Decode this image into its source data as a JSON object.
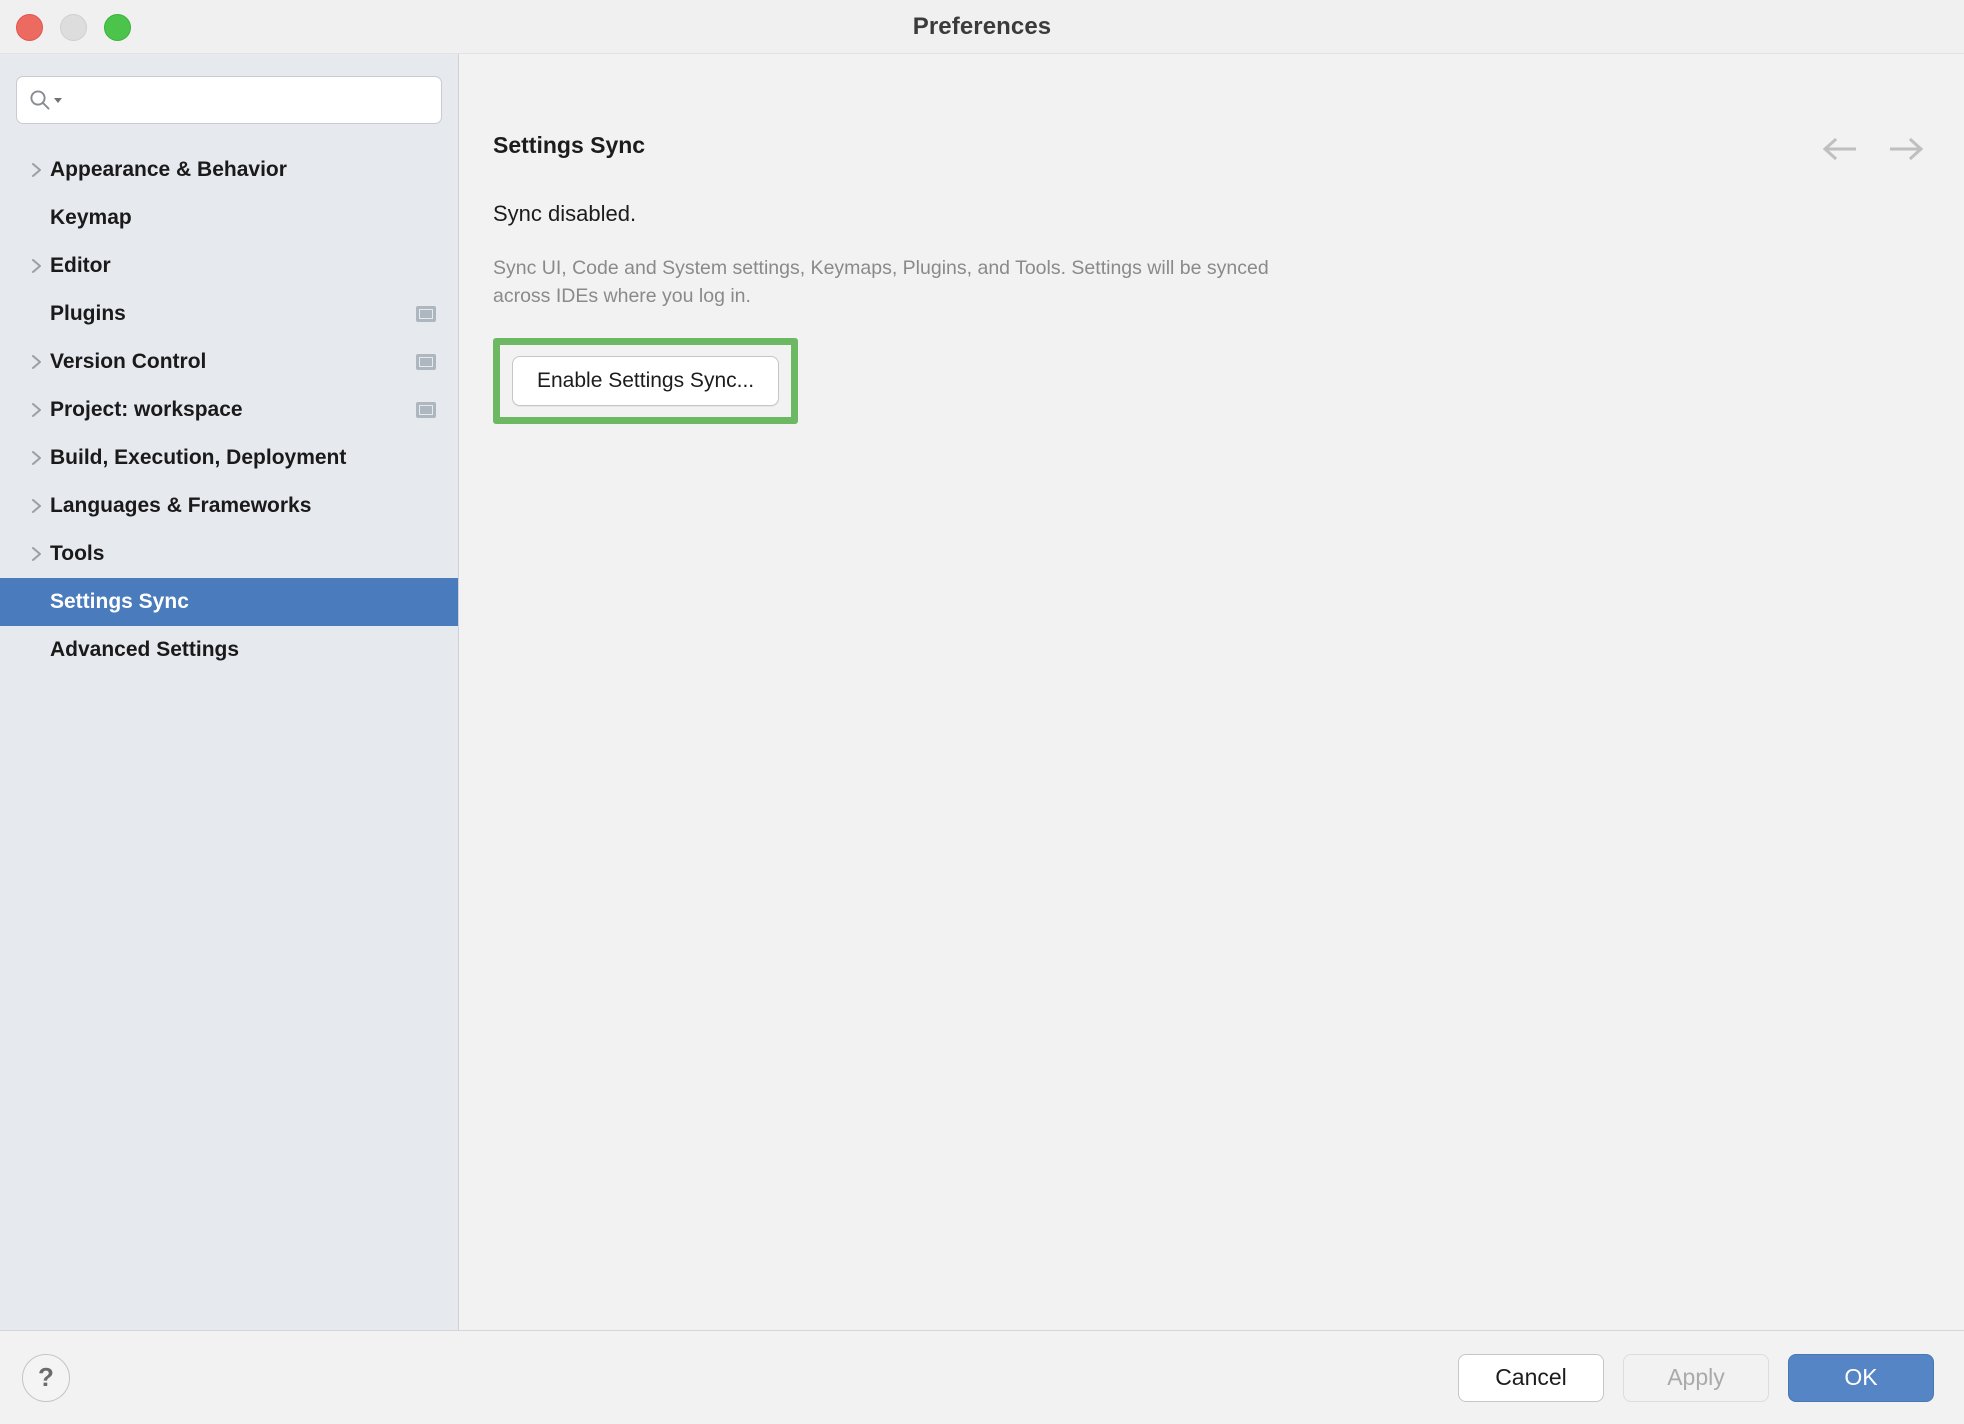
{
  "window": {
    "title": "Preferences",
    "traffic_lights": [
      "close",
      "minimize",
      "maximize"
    ]
  },
  "sidebar": {
    "search": {
      "value": "",
      "placeholder": ""
    },
    "items": [
      {
        "label": "Appearance & Behavior",
        "expandable": true,
        "selected": false,
        "badge": false
      },
      {
        "label": "Keymap",
        "expandable": false,
        "selected": false,
        "badge": false
      },
      {
        "label": "Editor",
        "expandable": true,
        "selected": false,
        "badge": false
      },
      {
        "label": "Plugins",
        "expandable": false,
        "selected": false,
        "badge": true
      },
      {
        "label": "Version Control",
        "expandable": true,
        "selected": false,
        "badge": true
      },
      {
        "label": "Project: workspace",
        "expandable": true,
        "selected": false,
        "badge": true
      },
      {
        "label": "Build, Execution, Deployment",
        "expandable": true,
        "selected": false,
        "badge": false
      },
      {
        "label": "Languages & Frameworks",
        "expandable": true,
        "selected": false,
        "badge": false
      },
      {
        "label": "Tools",
        "expandable": true,
        "selected": false,
        "badge": false
      },
      {
        "label": "Settings Sync",
        "expandable": false,
        "selected": true,
        "badge": false
      },
      {
        "label": "Advanced Settings",
        "expandable": false,
        "selected": false,
        "badge": false
      }
    ]
  },
  "content": {
    "title": "Settings Sync",
    "status": "Sync disabled.",
    "description": "Sync UI, Code and System settings, Keymaps, Plugins, and Tools. Settings will be synced across IDEs where you log in.",
    "enable_button": "Enable Settings Sync...",
    "nav_back": "back-arrow",
    "nav_forward": "forward-arrow"
  },
  "footer": {
    "help": "?",
    "cancel": "Cancel",
    "apply": "Apply",
    "ok": "OK"
  },
  "colors": {
    "selection_blue": "#4a7bbd",
    "highlight_green": "#6cb863",
    "ok_button_blue": "#5585c4",
    "sidebar_bg": "#e6e9ee",
    "content_bg": "#f2f2f2"
  }
}
